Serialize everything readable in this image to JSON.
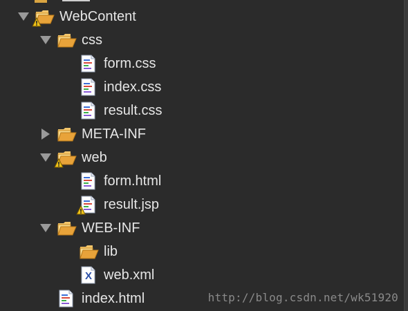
{
  "tree": {
    "items": [
      {
        "label": "WebContent",
        "depth": 0,
        "type": "folder-open",
        "expanded": true,
        "twisty": true,
        "warning": true
      },
      {
        "label": "css",
        "depth": 1,
        "type": "folder-open",
        "expanded": true,
        "twisty": true,
        "warning": false
      },
      {
        "label": "form.css",
        "depth": 2,
        "type": "file-css",
        "twisty": false,
        "warning": false
      },
      {
        "label": "index.css",
        "depth": 2,
        "type": "file-css",
        "twisty": false,
        "warning": false
      },
      {
        "label": "result.css",
        "depth": 2,
        "type": "file-css",
        "twisty": false,
        "warning": false
      },
      {
        "label": "META-INF",
        "depth": 1,
        "type": "folder-closed",
        "expanded": false,
        "twisty": true,
        "warning": false
      },
      {
        "label": "web",
        "depth": 1,
        "type": "folder-open",
        "expanded": true,
        "twisty": true,
        "warning": true
      },
      {
        "label": "form.html",
        "depth": 2,
        "type": "file-html",
        "twisty": false,
        "warning": false
      },
      {
        "label": "result.jsp",
        "depth": 2,
        "type": "file-jsp",
        "twisty": false,
        "warning": true
      },
      {
        "label": "WEB-INF",
        "depth": 1,
        "type": "folder-open",
        "expanded": true,
        "twisty": true,
        "warning": false
      },
      {
        "label": "lib",
        "depth": 2,
        "type": "folder-open",
        "twisty": false,
        "warning": false
      },
      {
        "label": "web.xml",
        "depth": 2,
        "type": "file-xml",
        "twisty": false,
        "warning": false
      },
      {
        "label": "index.html",
        "depth": 1,
        "type": "file-html",
        "twisty": false,
        "warning": false
      }
    ]
  },
  "watermark": "http://blog.csdn.net/wk51920",
  "colors": {
    "background": "#2b2b2b",
    "text": "#e6e6e6",
    "folder": "#e8a33a",
    "twisty": "#9a9a9a",
    "warning": "#f0c419"
  },
  "icons": {
    "folder-open": "open-folder-icon",
    "folder-closed": "closed-folder-icon",
    "file-css": "css-file-icon",
    "file-html": "html-file-icon",
    "file-jsp": "jsp-file-icon",
    "file-xml": "xml-file-icon",
    "warning": "warning-overlay-icon"
  }
}
